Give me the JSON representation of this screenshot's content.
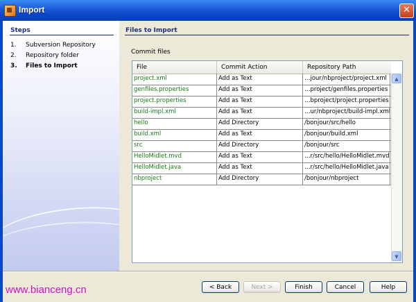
{
  "window": {
    "title": "Import"
  },
  "steps": {
    "title": "Steps",
    "items": [
      {
        "num": "1.",
        "label": "Subversion Repository"
      },
      {
        "num": "2.",
        "label": "Repository folder"
      },
      {
        "num": "3.",
        "label": "Files to Import"
      }
    ]
  },
  "main": {
    "title": "Files to Import",
    "commit_label": "Commit files",
    "columns": [
      "File",
      "Commit Action",
      "Repository Path"
    ],
    "rows": [
      {
        "file": "project.xml",
        "action": "Add as Text",
        "path": "…jour/nbproject/project.xml"
      },
      {
        "file": "genfiles.properties",
        "action": "Add as Text",
        "path": "…project/genfiles.properties"
      },
      {
        "file": "project.properties",
        "action": "Add as Text",
        "path": "…bproject/project.properties"
      },
      {
        "file": "build-impl.xml",
        "action": "Add as Text",
        "path": "…ur/nbproject/build-impl.xml"
      },
      {
        "file": "hello",
        "action": "Add Directory",
        "path": "/bonjour/src/hello"
      },
      {
        "file": "build.xml",
        "action": "Add as Text",
        "path": "/bonjour/build.xml"
      },
      {
        "file": "src",
        "action": "Add Directory",
        "path": "/bonjour/src"
      },
      {
        "file": "HelloMidlet.mvd",
        "action": "Add as Text",
        "path": "…r/src/hello/HelloMidlet.mvd"
      },
      {
        "file": "HelloMidlet.java",
        "action": "Add as Text",
        "path": "…r/src/hello/HelloMidlet.java"
      },
      {
        "file": "nbproject",
        "action": "Add Directory",
        "path": "/bonjour/nbproject"
      }
    ]
  },
  "buttons": {
    "back": "< Back",
    "next": "Next >",
    "finish": "Finish",
    "cancel": "Cancel",
    "help": "Help"
  },
  "watermark": "www.bianceng.cn",
  "icons": {
    "app": "netbeans-app-icon",
    "close": "close-icon",
    "scroll_up": "arrow-up-icon",
    "scroll_down": "arrow-down-icon"
  },
  "colors": {
    "titlebar": "#0a47c7",
    "file_text": "#1a7a1a",
    "section_title": "#1f2f7a",
    "watermark": "#d210c8"
  }
}
